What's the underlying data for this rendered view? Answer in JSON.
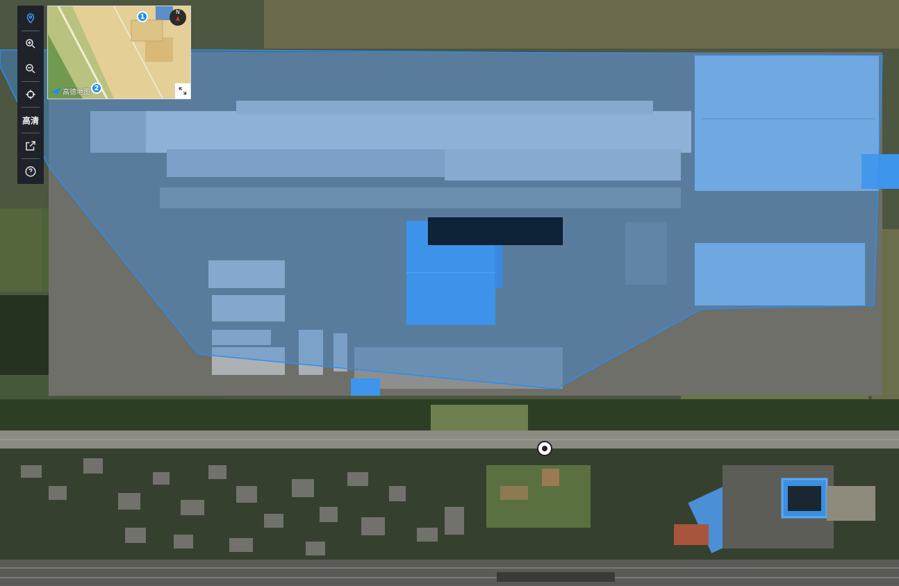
{
  "toolbar": {
    "buttons": [
      {
        "icon": "location-pin-icon",
        "active": true
      },
      {
        "icon": "zoom-in-icon"
      },
      {
        "icon": "zoom-out-icon"
      },
      {
        "icon": "crosshair-icon"
      },
      {
        "label": "高清"
      },
      {
        "icon": "external-link-icon"
      },
      {
        "icon": "help-icon"
      }
    ],
    "hd_label": "高清"
  },
  "minimap": {
    "logo_text": "高德地图",
    "compass_label": "N",
    "badge_1": "1",
    "badge_2": "2"
  },
  "colors": {
    "boundary_fill": "#3e8fe8",
    "boundary_stroke": "#2d8cf0",
    "highlight_roof": "#3d95ec",
    "toolbar_bg": "#1f2329"
  }
}
